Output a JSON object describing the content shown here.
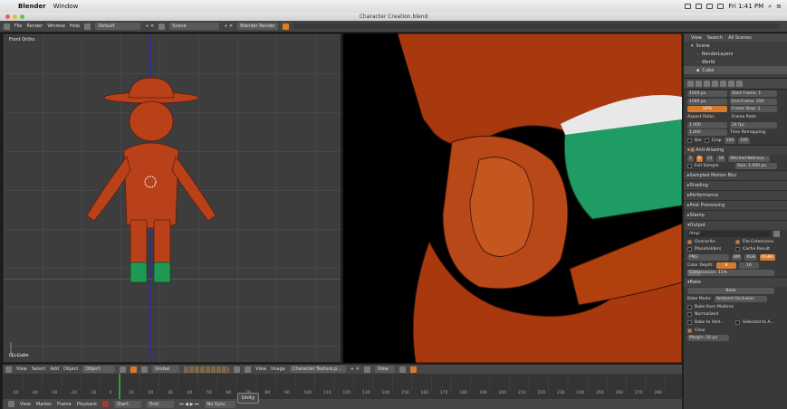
{
  "macbar": {
    "app_name": "Blender",
    "menu_window": "Window",
    "clock": "Fri 1:41 PM"
  },
  "titlebar": {
    "title": "Character Creation.blend"
  },
  "infobar": {
    "menus": [
      "File",
      "Render",
      "Window",
      "Help"
    ],
    "layout": "Default",
    "scene": "Scene",
    "engine": "Blender Render"
  },
  "viewport_left": {
    "view_label": "Front Ortho",
    "object_label": "(1) Cube"
  },
  "outliner": {
    "tabs": [
      "View",
      "Search",
      "All Scenes"
    ],
    "items": [
      "Scene",
      "RenderLayers",
      "World",
      "Cube"
    ]
  },
  "properties": {
    "resolution": {
      "x": "1920 px",
      "y": "1080 px",
      "percent": "50%"
    },
    "frames": {
      "start": "Start Frame: 1",
      "end": "End Frame: 250",
      "step": "Frame Step: 1"
    },
    "aspect_label": "Aspect Ratio:",
    "frame_rate_label": "Frame Rate:",
    "aspect": {
      "x": "1.000",
      "y": "1.000"
    },
    "fps": "24 fps",
    "time_remap_label": "Time Remapping:",
    "time_remap": {
      "old": "100",
      "new": "100"
    },
    "bor": "Bor",
    "crop": "Crop",
    "antialias": {
      "label": "Anti-Aliasing",
      "samples": [
        "5",
        "8",
        "11",
        "16"
      ],
      "filter": "Mitchell-Netrava...",
      "full_sample": "Full Sample",
      "size": "Size: 1.000 px"
    },
    "sections": [
      "Sampled Motion Blur",
      "Shading",
      "Performance",
      "Post Processing",
      "Stamp",
      "Output"
    ],
    "output": {
      "path": "/tmp/",
      "overwrite": "Overwrite",
      "file_ext": "File Extensions",
      "placeholders": "Placeholders",
      "cache": "Cache Result",
      "format": "PNG",
      "bw": "BW",
      "rgb": "RGB",
      "rgba": "RGBA",
      "color_depth_label": "Color Depth:",
      "depth_8": "8",
      "depth_16": "16",
      "compression": "Compression:",
      "compression_val": "15%"
    },
    "bake": {
      "label": "Bake",
      "button": "Bake",
      "mode_label": "Bake Mode:",
      "mode": "Ambient Occlusion",
      "from_multires": "Bake from Multires",
      "normalized": "Normalized",
      "bake_to_vertex": "Bake to Vert...",
      "selected_to_active": "Selected to A...",
      "clear": "Clear",
      "margin": "Margin: 16 px"
    }
  },
  "viewport_header": {
    "menus": [
      "View",
      "Select",
      "Add",
      "Object"
    ],
    "mode": "Object Mode",
    "pivot": "Global",
    "image_menus": [
      "View",
      "Image"
    ],
    "image_name": "Character Texture.p...",
    "view_btn": "View"
  },
  "timeline": {
    "ticks": [
      "-50",
      "-40",
      "-30",
      "-20",
      "-10",
      "0",
      "10",
      "20",
      "30",
      "40",
      "50",
      "60",
      "70",
      "80",
      "90",
      "100",
      "110",
      "120",
      "130",
      "140",
      "150",
      "160",
      "170",
      "180",
      "190",
      "200",
      "210",
      "220",
      "230",
      "240",
      "250",
      "260",
      "270",
      "280"
    ]
  },
  "bottombar": {
    "menus": [
      "View",
      "Marker",
      "Frame",
      "Playback"
    ],
    "start": "Start:",
    "end": "End:",
    "sync": "No Sync"
  },
  "tooltip": {
    "text": "Unity"
  },
  "colors": {
    "accent": "#d57b2f",
    "character_body": "#b8411a",
    "boots": "#1e9a54",
    "timeline_playhead": "#3a9a3a"
  }
}
